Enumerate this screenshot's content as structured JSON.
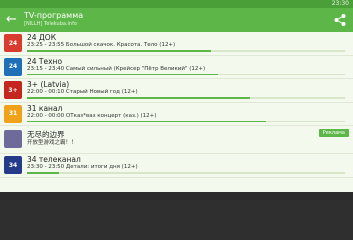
{
  "status_bar": {
    "time": "23:30"
  },
  "app_bar": {
    "title": "TV-программа",
    "subtitle": "[NILLH] Telekuba.info"
  },
  "channels": [
    {
      "name": "24 ДОК",
      "program": "23:25 - 23:55 Большой скачок. Красота. Тело (12+)",
      "logo_text": "24",
      "logo_color": "#d93b2e",
      "progress": 0.58
    },
    {
      "name": "24 Техно",
      "program": "23:15 - 23:40 Самый сильный (Крейсер \"Пётр Великий\" (12+)",
      "logo_text": "24",
      "logo_color": "#1f70b8",
      "progress": 0.6
    },
    {
      "name": "3+ (Latvia)",
      "program": "22:00 - 00:10 Старый Новый год (12+)",
      "logo_text": "3+",
      "logo_color": "#c5261f",
      "progress": 0.7
    },
    {
      "name": "31 канал",
      "program": "22:00 - 00:00 ОТказ*ваз концерт (каз.) (12+)",
      "logo_text": "31",
      "logo_color": "#f0a21a",
      "progress": 0.75
    },
    {
      "name": "无尽的边界",
      "program": "开放型游戏之霸！！",
      "logo_text": "",
      "logo_color": "#6e6a99",
      "progress": null,
      "badge": "Реклама"
    },
    {
      "name": "34 телеканал",
      "program": "23:30 - 23:50 Детали: итоги дня (12+)",
      "logo_text": "34",
      "logo_color": "#263a8a",
      "progress": 0.1
    }
  ],
  "icons": {
    "back": "back-arrow-icon",
    "share": "share-icon"
  }
}
